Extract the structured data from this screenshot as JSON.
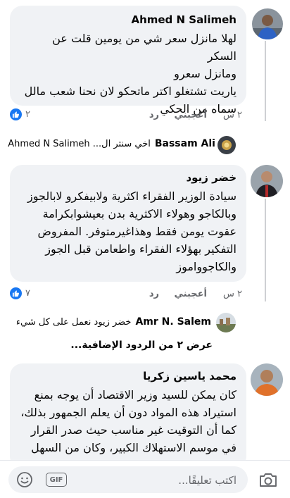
{
  "comments": [
    {
      "author": "Ahmed N Salimeh",
      "text": "لهلا مانزل سعر شي من يومين قلت عن السكر\nومانزل سعرو\nياريت تشتغلو اكتر ماتحكو لان نحنا شعب مالل\nسماه من الحكي",
      "time": "٢ س",
      "like_label": "أعجبني",
      "reply_label": "رد",
      "reaction_count": "٢"
    },
    {
      "author": "خضر زيود",
      "text": "سيادة الوزير الفقراء اكثرية ولابيفكرو لابالجوز\nوبالكاجو وهولاء الاكثرية بدن بعيشوابكرامة\nعقوت يومن فقط وهذاغيرمتوفر. المفروض\nالتفكير بهؤلاء الفقراء واطعامن قبل الجوز\nوالكاجوواموز",
      "time": "٢ س",
      "like_label": "أعجبني",
      "reply_label": "رد",
      "reaction_count": "٧"
    },
    {
      "author": "محمد ياسين زكريا",
      "text": "كان يمكن للسيد وزير الاقتصاد أن يوجه بمنع\nاستيراد هذه المواد دون أن يعلم الجمهور بذلك،\nكما أن التوقيت غير مناسب حيث صدر القرار\nفي موسم الاستهلاك الكبير، وكان من السهل"
    }
  ],
  "replies": [
    {
      "name": "Bassam Ali",
      "text": "اخي سنتر ال... Ahmed N Salimeh"
    },
    {
      "name": "Amr N. Salem",
      "text": "خضر زيود نعمل على كل شيء"
    }
  ],
  "more_replies": "عرض ٢ من الردود الإضافية...",
  "composer": {
    "placeholder": "اكتب تعليقًا...",
    "gif_label": "GIF"
  },
  "colors": {
    "bubble": "#f0f2f5",
    "like_blue": "#1877f2",
    "meta_gray": "#65676b"
  }
}
